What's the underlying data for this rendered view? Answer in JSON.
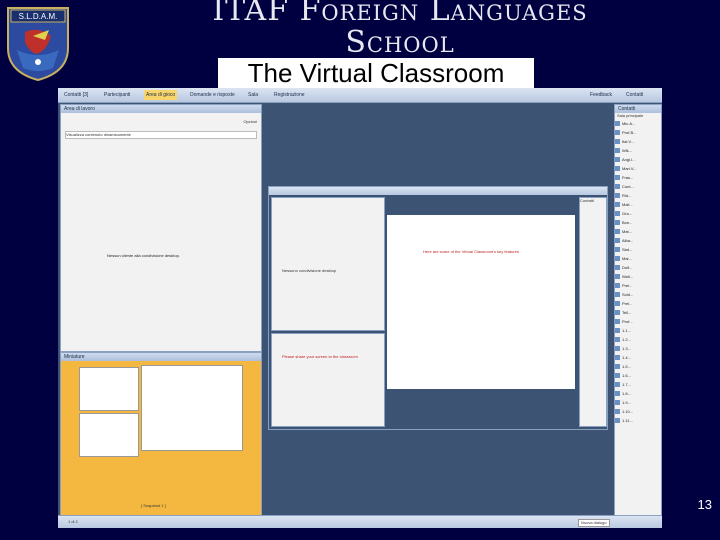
{
  "slide": {
    "title_line1": "ITAF Foreign Languages",
    "title_line2": "School",
    "subtitle": "The Virtual Classroom",
    "page_number": "13",
    "logo_text": "S.L.D.A.M."
  },
  "app": {
    "tabs": [
      "Contatti [3]",
      "Partecipanti",
      "Area di gioco",
      "Domande e risposte",
      "Sala",
      "Registrazione"
    ],
    "right_labels": [
      "Feedback",
      "Contatti"
    ],
    "left_pane": {
      "title": "Area di lavoro",
      "options": "Opzioni",
      "row": "Visualizza contenuto dinamicamente",
      "message": "Nessun cliente alla condivisione desktop."
    },
    "bottom_left_pane": {
      "title": "Miniature",
      "snapshot": "[ Snapshot 1 ]",
      "page": "1 di 2"
    },
    "nested": {
      "message": "Here are some of the Virtual Classroom's key features",
      "inner_pane": "Nessuno condivisione desktop",
      "inner_bottom": "Please share your screen to the classroom",
      "right_title": "Contatti"
    },
    "sidebar": {
      "title": "Contatti",
      "subtitle": "Sala principale",
      "items": [
        "Mic.A...",
        "Prof.B...",
        "Ital.V...",
        "Wik...",
        "Angl.I...",
        "Mari.V...",
        "Fras...",
        "Cont...",
        "Rid...",
        "Mall...",
        "Gra...",
        "Bon...",
        "Mat...",
        "Alba...",
        "Siat...",
        "Mal...",
        "Dolf...",
        "Wall...",
        "Prel...",
        "Sold...",
        "Prel...",
        "Tell...",
        "Prof...",
        "1.1...",
        "1.2...",
        "1.3...",
        "1.4...",
        "1.5...",
        "1.6...",
        "1.7...",
        "1.8...",
        "1.9...",
        "1.10...",
        "1.11..."
      ],
      "footer": "Nuova dialogo"
    }
  }
}
